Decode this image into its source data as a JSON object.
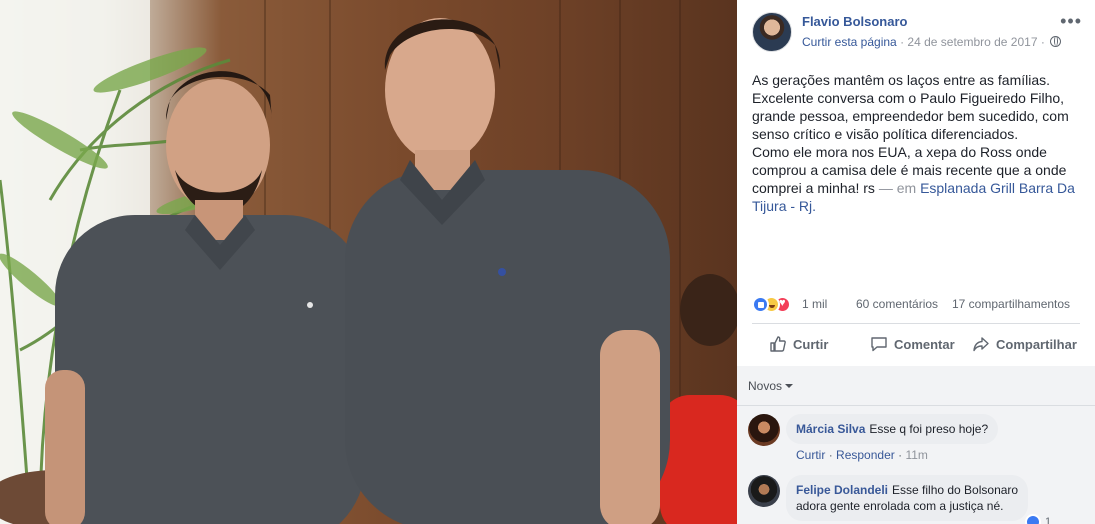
{
  "post": {
    "page_name": "Flavio Bolsonaro",
    "like_page": "Curtir esta página",
    "date": "24 de setembro de 2017",
    "text_lines": [
      "As gerações mantêm os laços entre as famílias.",
      "Excelente conversa com o Paulo Figueiredo Filho, grande pessoa, empreendedor bem sucedido, com senso crítico e visão política diferenciados.",
      "Como ele mora nos EUA, a xepa do Ross onde comprou a camisa dele é mais recente que a onde comprei a minha! rs"
    ],
    "place_sep": "— em",
    "place": "Esplanada Grill Barra Da Tijura - Rj."
  },
  "stats": {
    "reactions": "1 mil",
    "comments": "60 comentários",
    "shares": "17 compartilhamentos"
  },
  "actions": {
    "like": "Curtir",
    "comment": "Comentar",
    "share": "Compartilhar"
  },
  "comments": {
    "sort_label": "Novos",
    "items": [
      {
        "author": "Márcia Silva",
        "text": "Esse q foi preso hoje?",
        "like_link": "Curtir",
        "reply_link": "Responder",
        "time": "11m"
      },
      {
        "author": "Felipe Dolandeli",
        "text_line1": "Esse filho do Bolsonaro",
        "text_line2": "adora gente enrolada com a justiça né.",
        "like_count": "1"
      }
    ]
  },
  "colors": {
    "link": "#365899",
    "muted": "#90949c",
    "like_blue": "#3b7af2",
    "love_red": "#f33e58"
  }
}
